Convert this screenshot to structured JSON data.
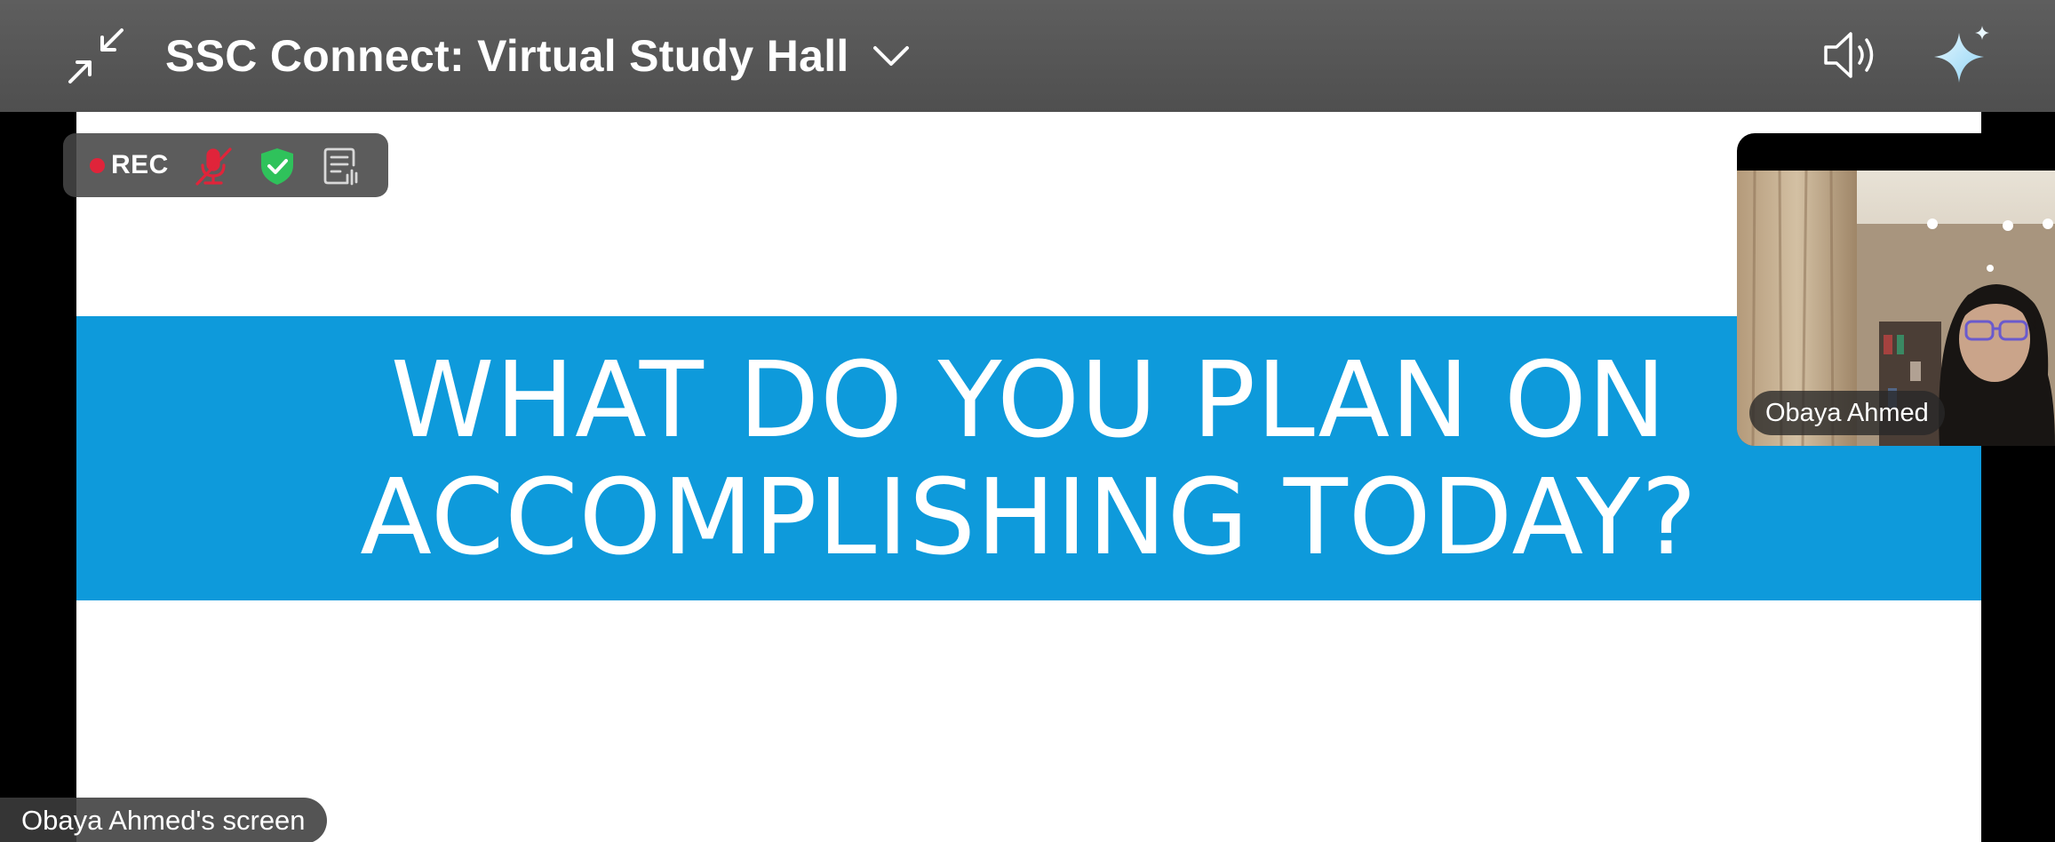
{
  "header": {
    "title": "SSC Connect: Virtual Study Hall",
    "icons": {
      "exit_fullscreen": "exit-fullscreen-icon",
      "title_dropdown": "chevron-down-icon",
      "speaker": "speaker-icon",
      "ai_assistant": "sparkle-icon"
    }
  },
  "status": {
    "rec_label": "REC",
    "icons": [
      "record-dot-icon",
      "microphone-muted-icon",
      "shield-check-icon",
      "transcript-icon"
    ],
    "colors": {
      "rec": "#e0243a",
      "muted": "#e0243a",
      "shield": "#2fc25b"
    }
  },
  "shared_screen": {
    "owner_label": "Obaya Ahmed's screen",
    "slide_line_1": "WHAT DO YOU PLAN ON",
    "slide_line_2": "ACCOMPLISHING TODAY?",
    "banner_color": "#0e9adb"
  },
  "participant": {
    "name": "Obaya Ahmed"
  }
}
